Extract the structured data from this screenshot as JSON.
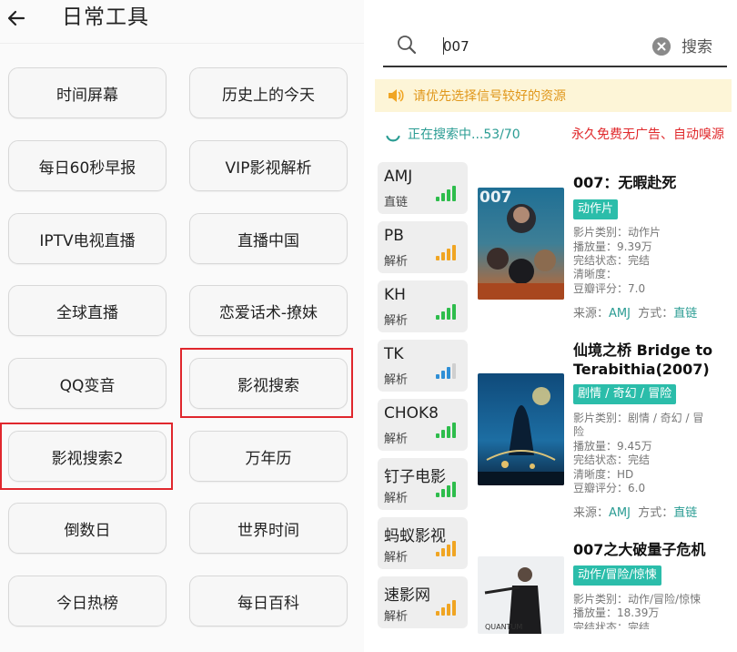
{
  "left": {
    "title": "日常工具",
    "buttons": [
      "时间屏幕",
      "历史上的今天",
      "每日60秒早报",
      "VIP影视解析",
      "IPTV电视直播",
      "直播中国",
      "全球直播",
      "恋爱话术-撩妹",
      "QQ变音",
      "影视搜索",
      "影视搜索2",
      "万年历",
      "倒数日",
      "世界时间",
      "今日热榜",
      "每日百科"
    ]
  },
  "right": {
    "search": {
      "value": "007",
      "button": "搜索"
    },
    "notice": "请优先选择信号较好的资源",
    "status": "正在搜索中...53/70",
    "slogan": "永久免费无广告、自动嗅源",
    "sources": [
      {
        "name": "AMJ",
        "type": "直链",
        "signal_color": "#2ebd4c",
        "signal_level": 4
      },
      {
        "name": "PB",
        "type": "解析",
        "signal_color": "#f0a523",
        "signal_level": 4
      },
      {
        "name": "KH",
        "type": "解析",
        "signal_color": "#2ebd4c",
        "signal_level": 4
      },
      {
        "name": "TK",
        "type": "解析",
        "signal_color": "#2f8fd6",
        "signal_level": 3
      },
      {
        "name": "CHOK8",
        "type": "解析",
        "signal_color": "#2ebd4c",
        "signal_level": 4
      },
      {
        "name": "钉子电影",
        "type": "解析",
        "signal_color": "#2ebd4c",
        "signal_level": 4
      },
      {
        "name": "蚂蚁影视",
        "type": "解析",
        "signal_color": "#f0a523",
        "signal_level": 4
      },
      {
        "name": "速影网",
        "type": "解析",
        "signal_color": "#f0a523",
        "signal_level": 4
      }
    ],
    "movies": [
      {
        "title": "007：无暇赴死",
        "tags": "动作片",
        "category": "影片类别：动作片",
        "plays": "播放量：9.39万",
        "state": "完结状态：完结",
        "definition": "清晰度：",
        "score": "豆瓣评分：7.0",
        "source_label": "来源：",
        "source": "AMJ",
        "mode_label": "方式：",
        "mode": "直链"
      },
      {
        "title": "仙境之桥 Bridge to Terabithia(2007)",
        "tags": "剧情 / 奇幻 / 冒险",
        "category": "影片类别：剧情 / 奇幻 / 冒",
        "category2": "险",
        "plays": "播放量：9.45万",
        "state": "完结状态：完结",
        "definition": "清晰度：HD",
        "score": "豆瓣评分：6.0",
        "source_label": "来源：",
        "source": "AMJ",
        "mode_label": "方式：",
        "mode": "直链"
      },
      {
        "title": "007之大破量子危机",
        "tags": "动作/冒险/惊悚",
        "category": "影片类别：动作/冒险/惊悚",
        "plays": "播放量：18.39万",
        "state": "完结状态：完结"
      }
    ]
  },
  "colors": {
    "accent_teal": "#2bbdaa",
    "highlight_red": "#e0272d",
    "notice_orange": "#e0971b"
  }
}
